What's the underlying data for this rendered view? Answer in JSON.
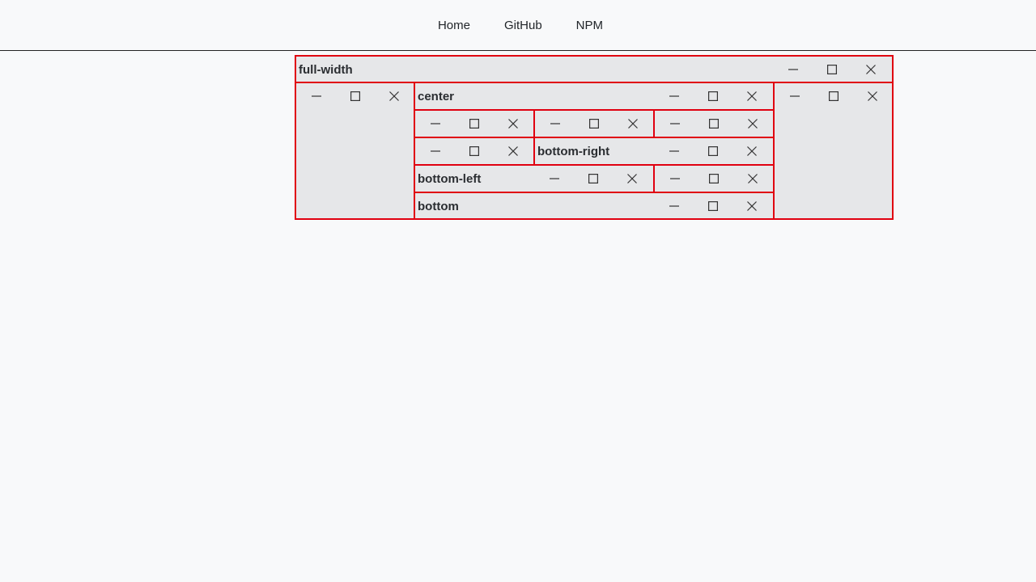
{
  "nav": {
    "links": [
      {
        "label": "Home"
      },
      {
        "label": "GitHub"
      },
      {
        "label": "NPM"
      }
    ]
  },
  "windows": {
    "full_width": {
      "title": "full-width"
    },
    "left": {
      "title": ""
    },
    "center": {
      "title": "center"
    },
    "right": {
      "title": ""
    },
    "cell_a": {
      "title": ""
    },
    "cell_b": {
      "title": ""
    },
    "cell_c": {
      "title": ""
    },
    "cell_d": {
      "title": ""
    },
    "bottom_right": {
      "title": "bottom-right"
    },
    "bottom_left": {
      "title": "bottom-left"
    },
    "cell_e": {
      "title": ""
    },
    "bottom": {
      "title": "bottom"
    }
  },
  "colors": {
    "border": "#e00010",
    "window_bg": "#e6e7e9",
    "page_bg": "#f8f9fa"
  },
  "icons": [
    "minimize-icon",
    "maximize-icon",
    "close-icon"
  ]
}
